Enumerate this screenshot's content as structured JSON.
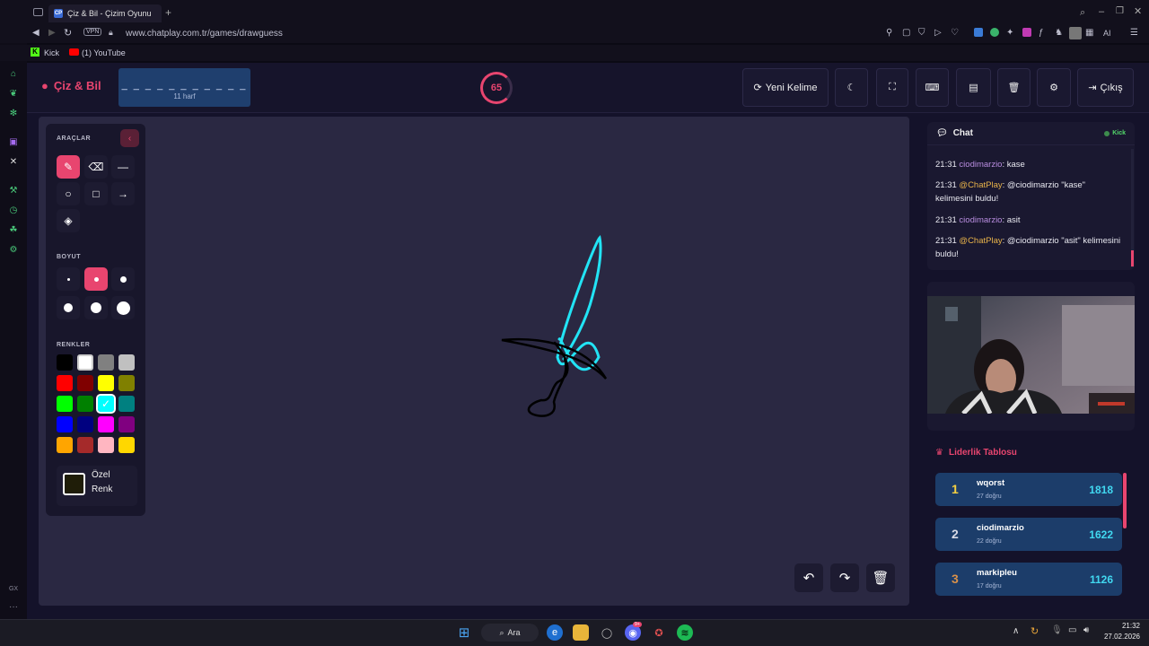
{
  "browser": {
    "tab_title": "Çiz & Bil - Çizim Oyunu",
    "tab_favicon": "CP",
    "add_tab": "+",
    "url": "www.chatplay.com.tr/games/drawguess",
    "vpn": "VPN",
    "bookmarks": [
      {
        "label": "Kick",
        "icon": "kick-icon"
      },
      {
        "label": "(1) YouTube",
        "icon": "youtube-icon"
      }
    ],
    "ext_ai": "AI"
  },
  "header": {
    "brand": "Çiz & Bil",
    "word_mask": "_ _ _ _ _ _ _ _ _ _ _",
    "word_length": "11 harf",
    "timer": "65",
    "timer_fraction": 0.8,
    "new_word_label": "Yeni Kelime",
    "exit_label": "Çıkış",
    "accent": "#e8456f"
  },
  "tools": {
    "section_tools": "ARAÇLAR",
    "section_size": "BOYUT",
    "section_colors": "RENKLER",
    "custom_color_line1": "Özel",
    "custom_color_line2": "Renk",
    "custom_color_value": "#1f1d08",
    "colors": [
      "#000000",
      "#ffffff",
      "#808080",
      "#c0c0c0",
      "#ff0000",
      "#800000",
      "#ffff00",
      "#808000",
      "#00ff00",
      "#008000",
      "#00ffff",
      "#008080",
      "#0000ff",
      "#000080",
      "#ff00ff",
      "#800080",
      "#ffa500",
      "#a52a2a",
      "#ffb6c1",
      "#ffd700"
    ],
    "selected_color": "#00ffff"
  },
  "chat": {
    "title": "Chat",
    "source": "Kick",
    "messages": [
      {
        "time": "21:31",
        "user": "ciodimarzio",
        "text": "kase",
        "bot": false
      },
      {
        "time": "21:31",
        "user": "@ChatPlay",
        "text": "@ciodimarzio \"kase\" kelimesini buldu!",
        "bot": true
      },
      {
        "time": "21:31",
        "user": "ciodimarzio",
        "text": "asit",
        "bot": false
      },
      {
        "time": "21:31",
        "user": "@ChatPlay",
        "text": "@ciodimarzio \"asit\" kelimesini buldu!",
        "bot": true
      }
    ]
  },
  "leaderboard": {
    "title": "Liderlik Tablosu",
    "rows": [
      {
        "rank": "1",
        "name": "wqorst",
        "sub": "27 doğru",
        "score": "1818",
        "rank_color": "#f5d142"
      },
      {
        "rank": "2",
        "name": "ciodimarzio",
        "sub": "22 doğru",
        "score": "1622",
        "rank_color": "#d8dbe6"
      },
      {
        "rank": "3",
        "name": "markipleu",
        "sub": "17 doğru",
        "score": "1126",
        "rank_color": "#d9914a"
      }
    ]
  },
  "taskbar": {
    "search_label": "Ara",
    "time": "21:32",
    "date": "27.02.2026",
    "discord_badge": "9+"
  },
  "sidebar": {
    "bottom_label": "GX",
    "more": "···"
  }
}
